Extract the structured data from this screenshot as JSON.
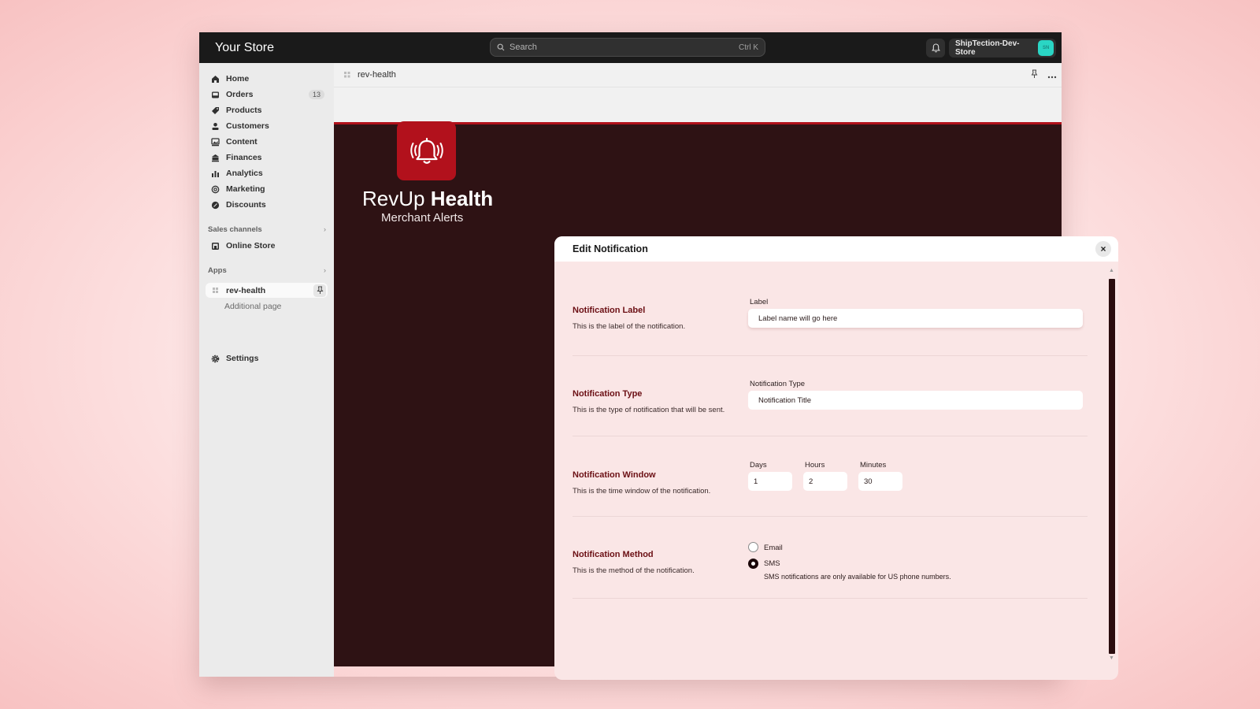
{
  "topbar": {
    "store_name": "Your Store",
    "search_placeholder": "Search",
    "search_shortcut": "Ctrl K",
    "store_switcher_label": "ShipTection-Dev-Store",
    "store_avatar_initials": "SN"
  },
  "sidebar": {
    "items": [
      {
        "label": "Home",
        "icon": "home-icon"
      },
      {
        "label": "Orders",
        "icon": "inbox-icon",
        "badge": "13"
      },
      {
        "label": "Products",
        "icon": "tag-icon"
      },
      {
        "label": "Customers",
        "icon": "person-icon"
      },
      {
        "label": "Content",
        "icon": "image-icon"
      },
      {
        "label": "Finances",
        "icon": "bank-icon"
      },
      {
        "label": "Analytics",
        "icon": "bar-chart-icon"
      },
      {
        "label": "Marketing",
        "icon": "target-icon"
      },
      {
        "label": "Discounts",
        "icon": "discount-icon"
      }
    ],
    "sales_channels_label": "Sales channels",
    "online_store_label": "Online Store",
    "apps_label": "Apps",
    "app_item_label": "rev-health",
    "app_subitem_label": "Additional page",
    "settings_label": "Settings"
  },
  "main": {
    "breadcrumb": "rev-health",
    "brand_light": "RevUp",
    "brand_bold": "Health",
    "brand_subtitle": "Merchant Alerts",
    "colors": {
      "accent": "#b2111c",
      "dark_bg": "#2e1214",
      "modal_bg": "#fae6e6"
    }
  },
  "modal": {
    "title": "Edit Notification",
    "close_label": "×",
    "sections": {
      "label": {
        "title": "Notification Label",
        "description": "This is the label of the notification.",
        "field_label": "Label",
        "value": "Label name will go here"
      },
      "type": {
        "title": "Notification Type",
        "description": "This is the type of notification that will be sent.",
        "field_label": "Notification Type",
        "value": "Notification Title"
      },
      "window": {
        "title": "Notification Window",
        "description": "This is the time window of the notification.",
        "days_label": "Days",
        "days_value": "1",
        "hours_label": "Hours",
        "hours_value": "2",
        "minutes_label": "Minutes",
        "minutes_value": "30"
      },
      "method": {
        "title": "Notification Method",
        "description": "This is the method of the notification.",
        "options": [
          {
            "label": "Email",
            "checked": false
          },
          {
            "label": "SMS",
            "checked": true
          }
        ],
        "sms_note": "SMS notifications are only available for US phone numbers."
      }
    }
  }
}
